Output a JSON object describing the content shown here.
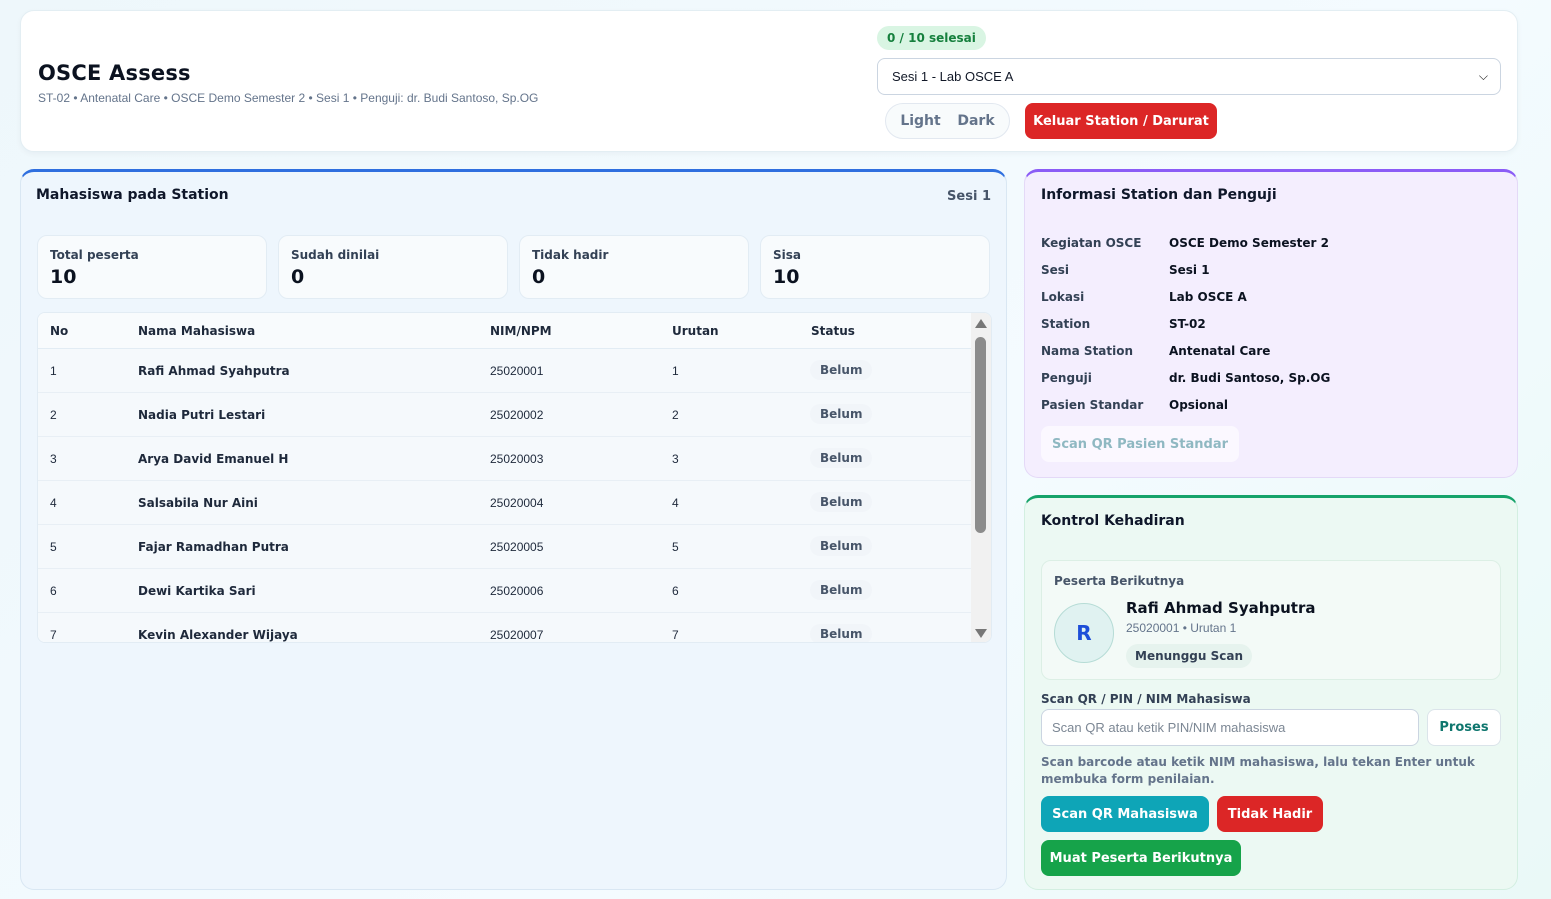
{
  "header": {
    "title": "OSCE Assess",
    "subtitle": "ST-02 • Antenatal Care • OSCE Demo Semester 2 • Sesi 1 • Penguji: dr. Budi Santoso, Sp.OG",
    "progress": "0 / 10 selesai",
    "session_select": "Sesi 1 - Lab OSCE A",
    "theme_light": "Light",
    "theme_dark": "Dark",
    "exit_button": "Keluar Station / Darurat"
  },
  "students_panel": {
    "title": "Mahasiswa pada Station",
    "session": "Sesi 1",
    "stats": [
      {
        "label": "Total peserta",
        "value": "10"
      },
      {
        "label": "Sudah dinilai",
        "value": "0"
      },
      {
        "label": "Tidak hadir",
        "value": "0"
      },
      {
        "label": "Sisa",
        "value": "10"
      }
    ],
    "columns": [
      "No",
      "Nama Mahasiswa",
      "NIM/NPM",
      "Urutan",
      "Status"
    ],
    "rows": [
      {
        "no": "1",
        "name": "Rafi Ahmad Syahputra",
        "nim": "25020001",
        "order": "1",
        "status": "Belum"
      },
      {
        "no": "2",
        "name": "Nadia Putri Lestari",
        "nim": "25020002",
        "order": "2",
        "status": "Belum"
      },
      {
        "no": "3",
        "name": "Arya David Emanuel H",
        "nim": "25020003",
        "order": "3",
        "status": "Belum"
      },
      {
        "no": "4",
        "name": "Salsabila Nur Aini",
        "nim": "25020004",
        "order": "4",
        "status": "Belum"
      },
      {
        "no": "5",
        "name": "Fajar Ramadhan Putra",
        "nim": "25020005",
        "order": "5",
        "status": "Belum"
      },
      {
        "no": "6",
        "name": "Dewi Kartika Sari",
        "nim": "25020006",
        "order": "6",
        "status": "Belum"
      },
      {
        "no": "7",
        "name": "Kevin Alexander Wijaya",
        "nim": "25020007",
        "order": "7",
        "status": "Belum"
      }
    ]
  },
  "info_panel": {
    "title": "Informasi Station dan Penguji",
    "items": [
      {
        "key": "Kegiatan OSCE",
        "value": "OSCE Demo Semester 2"
      },
      {
        "key": "Sesi",
        "value": "Sesi 1"
      },
      {
        "key": "Lokasi",
        "value": "Lab OSCE A"
      },
      {
        "key": "Station",
        "value": "ST-02"
      },
      {
        "key": "Nama Station",
        "value": "Antenatal Care"
      },
      {
        "key": "Penguji",
        "value": "dr. Budi Santoso, Sp.OG"
      },
      {
        "key": "Pasien Standar",
        "value": "Opsional"
      }
    ],
    "scan_sp_button": "Scan QR Pasien Standar"
  },
  "attendance_panel": {
    "title": "Kontrol Kehadiran",
    "next_label": "Peserta Berikutnya",
    "avatar_initial": "R",
    "next_name": "Rafi Ahmad Syahputra",
    "next_meta": "25020001 • Urutan 1",
    "next_status": "Menunggu Scan",
    "scan_label": "Scan QR / PIN / NIM Mahasiswa",
    "scan_placeholder": "Scan QR atau ketik PIN/NIM mahasiswa",
    "process_button": "Proses",
    "hint": "Scan barcode atau ketik NIM mahasiswa, lalu tekan Enter untuk membuka form penilaian.",
    "scan_button": "Scan QR Mahasiswa",
    "absent_button": "Tidak Hadir",
    "load_next_button": "Muat Peserta Berikutnya"
  }
}
